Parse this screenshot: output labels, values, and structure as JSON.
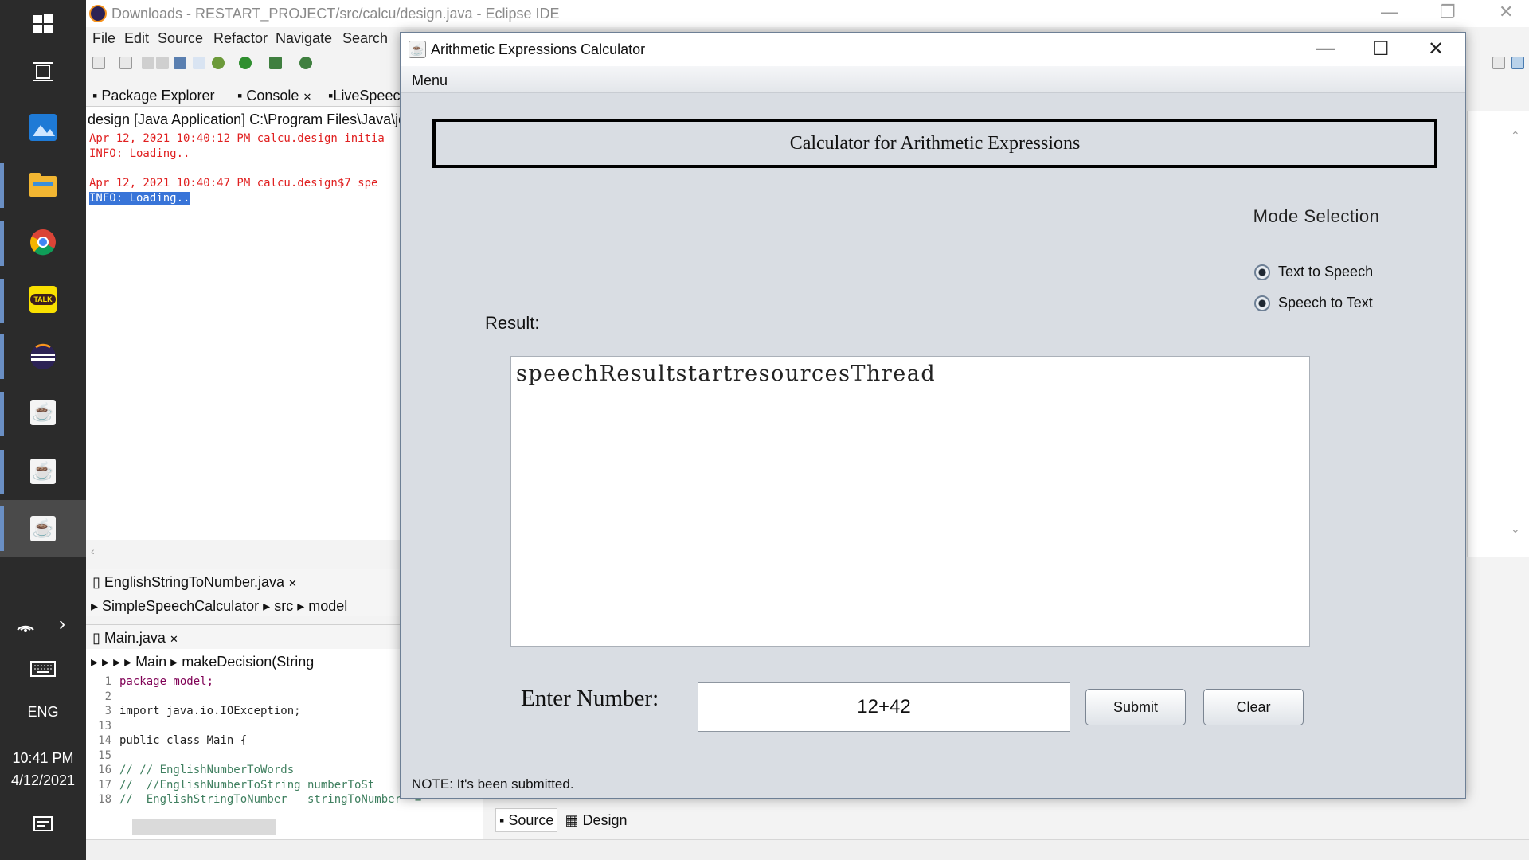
{
  "taskbar": {
    "language": "ENG",
    "time": "10:41 PM",
    "date": "4/12/2021",
    "kakao_label": "TALK"
  },
  "eclipse": {
    "title": "Downloads - RESTART_PROJECT/src/calcu/design.java - Eclipse IDE",
    "menu": [
      "File",
      "Edit",
      "Source",
      "Refactor",
      "Navigate",
      "Search"
    ],
    "tabs": {
      "package_explorer": "Package Explorer",
      "console": "Console",
      "livespeech": "LiveSpeec"
    },
    "console_header": "design [Java Application] C:\\Program Files\\Java\\jd",
    "console_lines": [
      "Apr 12, 2021 10:40:12 PM calcu.design initia",
      "INFO: Loading..",
      "Apr 12, 2021 10:40:47 PM calcu.design$7 spe",
      "INFO: Loading.."
    ],
    "editor1": {
      "tab": "EnglishStringToNumber.java",
      "breadcrumb": [
        "SimpleSpeechCalculator",
        "src",
        "model"
      ]
    },
    "editor2": {
      "tab": "Main.java",
      "breadcrumb": [
        "Main",
        "makeDecision(String"
      ],
      "lines": [
        {
          "n": "1",
          "code": "package model;"
        },
        {
          "n": "2",
          "code": ""
        },
        {
          "n": "3",
          "code": "import java.io.IOException;"
        },
        {
          "n": "13",
          "code": ""
        },
        {
          "n": "14",
          "code": "public class Main {"
        },
        {
          "n": "15",
          "code": ""
        },
        {
          "n": "16",
          "code": "//  // EnglishNumberToWords"
        },
        {
          "n": "17",
          "code": "//  //EnglishNumberToString numberToSt"
        },
        {
          "n": "18",
          "code": "//  EnglishStringToNumber   stringToNumber  = "
        }
      ]
    },
    "bottom_tabs": {
      "source": "Source",
      "design": "Design"
    }
  },
  "calculator": {
    "title": "Arithmetic Expressions Calculator",
    "menu": "Menu",
    "header": "Calculator for Arithmetic Expressions",
    "mode_title": "Mode Selection",
    "modes": [
      "Text to Speech",
      "Speech to Text"
    ],
    "result_label": "Result:",
    "result_text": "speechResultstartresourcesThread",
    "enter_label": "Enter Number:",
    "input_value": "12+42",
    "submit": "Submit",
    "clear": "Clear",
    "note": "NOTE: It's been submitted."
  },
  "colors": {
    "taskbar": "#2b2b2b",
    "calc_bg": "#d9dde3",
    "console_error": "#e02020",
    "selection": "#3874d8"
  }
}
